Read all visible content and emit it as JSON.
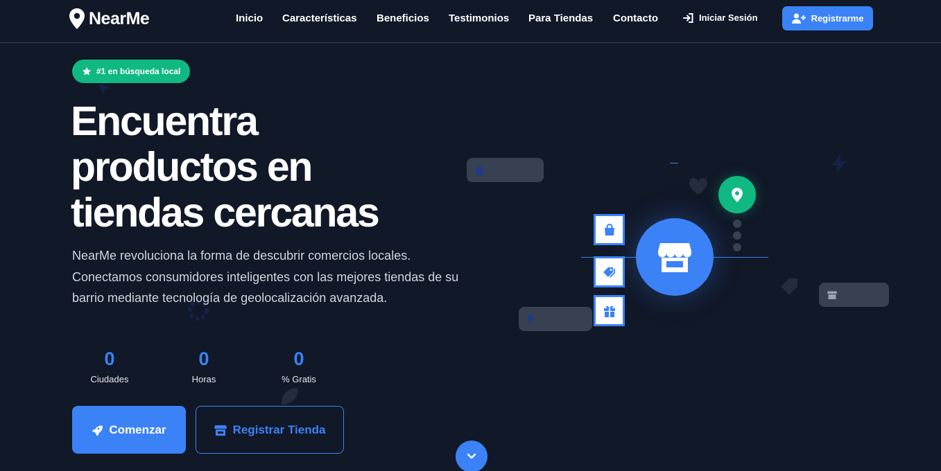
{
  "nav": {
    "brand": "NearMe",
    "links": [
      "Inicio",
      "Características",
      "Beneficios",
      "Testimonios",
      "Para Tiendas",
      "Contacto"
    ],
    "login_label": "Iniciar Sesión",
    "register_label": "Registrarme"
  },
  "hero": {
    "badge": "#1 en búsqueda local",
    "headline_lines": [
      "Encuentra",
      "productos en",
      "tiendas cercanas"
    ],
    "description": "NearMe revoluciona la forma de descubrir comercios locales. Conectamos consumidores inteligentes con las mejores tiendas de su barrio mediante tecnología de geolocalización avanzada.",
    "stats": [
      {
        "value": "0",
        "label": "Ciudades"
      },
      {
        "value": "0",
        "label": "Horas"
      },
      {
        "value": "0",
        "label": "% Gratis"
      }
    ],
    "primary_cta": "Comenzar",
    "secondary_cta": "Registrar Tienda"
  },
  "colors": {
    "background": "#111827",
    "accent_blue": "#3b82f6",
    "accent_green": "#10b981",
    "chip_gray": "#374151"
  },
  "icons": {
    "brand": "map-marker-icon",
    "login": "sign-in-icon",
    "register": "user-plus-icon",
    "badge": "star-icon",
    "primary_cta": "rocket-icon",
    "secondary_cta": "store-icon",
    "scroll": "chevron-down-icon",
    "illustration": [
      "store-icon",
      "map-pin-icon",
      "shopping-bag-icon",
      "tags-icon",
      "gift-icon"
    ]
  }
}
